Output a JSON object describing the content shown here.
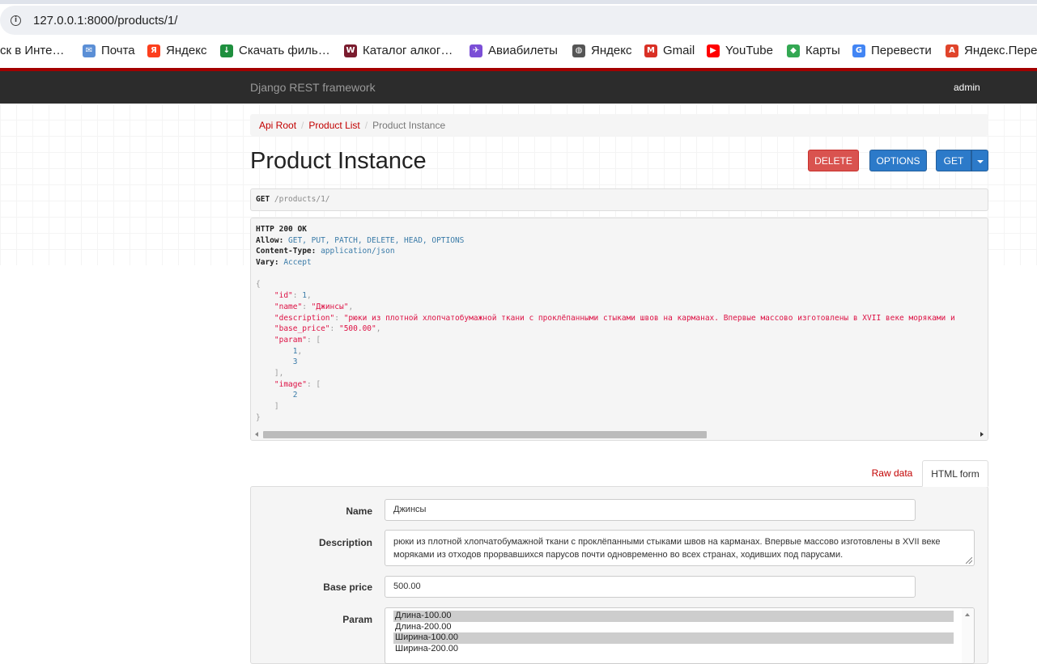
{
  "browser": {
    "url": "127.0.0.1:8000/products/1/",
    "bookmarks": [
      {
        "label": "ск в Инте…",
        "icon": "none",
        "color": ""
      },
      {
        "label": "Почта",
        "icon": "mail-icon",
        "color": "#5b8fd6"
      },
      {
        "label": "Яндекс",
        "icon": "yandex-icon",
        "color": "#fc3f1d"
      },
      {
        "label": "Скачать филь…",
        "icon": "download-icon",
        "color": "#1e8f3e"
      },
      {
        "label": "Каталог алког…",
        "icon": "winestore-icon",
        "color": "#7a1c2e"
      },
      {
        "label": "Авиабилеты",
        "icon": "plane-icon",
        "color": "#7b4fd6"
      },
      {
        "label": "Яндекс",
        "icon": "globe-icon",
        "color": "#555555"
      },
      {
        "label": "Gmail",
        "icon": "gmail-icon",
        "color": "#d93025"
      },
      {
        "label": "YouTube",
        "icon": "youtube-icon",
        "color": "#ff0000"
      },
      {
        "label": "Карты",
        "icon": "maps-icon",
        "color": "#34a853"
      },
      {
        "label": "Перевести",
        "icon": "translate-icon",
        "color": "#4285f4"
      },
      {
        "label": "Яндекс.Пере",
        "icon": "yandex-translate-icon",
        "color": "#e0442b"
      }
    ]
  },
  "navbar": {
    "brand": "Django REST framework",
    "user": "admin"
  },
  "breadcrumb": {
    "items": [
      "Api Root",
      "Product List"
    ],
    "active": "Product Instance"
  },
  "page": {
    "title": "Product Instance",
    "buttons": {
      "delete": "DELETE",
      "options": "OPTIONS",
      "get": "GET"
    }
  },
  "request": {
    "method": "GET",
    "path": " /products/1/"
  },
  "response": {
    "status": "HTTP 200 OK",
    "allow_key": "Allow:",
    "allow_val": " GET, PUT, PATCH, DELETE, HEAD, OPTIONS",
    "ctype_key": "Content-Type:",
    "ctype_val": " application/json",
    "vary_key": "Vary:",
    "vary_val": " Accept",
    "body": {
      "id": "1",
      "name": "\"Джинсы\"",
      "description": "\"рюки из плотной хлопчатобумажной ткани с проклёпанными стыками швов на карманах. Впервые массово изготовлены в XVII веке моряками и",
      "base_price": "\"500.00\"",
      "param": [
        "1",
        "3"
      ],
      "image": [
        "2"
      ]
    }
  },
  "tabs": {
    "raw": "Raw data",
    "html": "HTML form"
  },
  "form": {
    "name_label": "Name",
    "name_value": "Джинсы",
    "description_label": "Description",
    "description_value": "рюки из плотной хлопчатобумажной ткани с проклёпанными стыками швов на карманах. Впервые массово изготовлены в XVII веке моряками из отходов прорвавшихся парусов почти одновременно во всех странах, ходивших под парусами.",
    "price_label": "Base price",
    "price_value": "500.00",
    "param_label": "Param",
    "param_options": [
      {
        "label": "Длина-100.00",
        "selected": true
      },
      {
        "label": "Длина-200.00",
        "selected": false
      },
      {
        "label": "Ширина-100.00",
        "selected": true
      },
      {
        "label": "Ширина-200.00",
        "selected": false
      }
    ]
  }
}
